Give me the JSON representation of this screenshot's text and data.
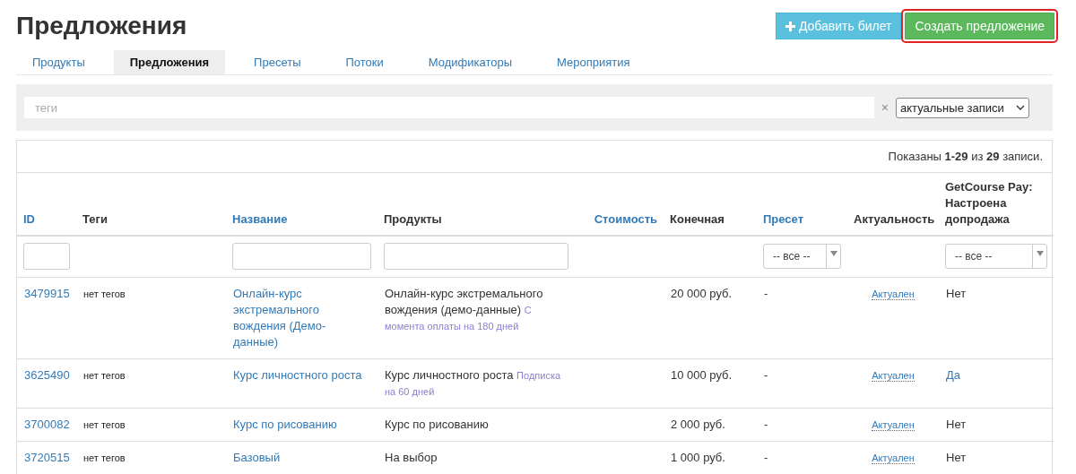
{
  "page_title": "Предложения",
  "actions": [
    {
      "kind": "add",
      "label": "Добавить билет",
      "highlighted": false
    },
    {
      "kind": "create",
      "label": "Создать предложение",
      "highlighted": true
    }
  ],
  "tabs": [
    {
      "label": "Продукты",
      "selected": false
    },
    {
      "label": "Предложения",
      "selected": true
    },
    {
      "label": "Пресеты",
      "selected": false
    },
    {
      "label": "Потоки",
      "selected": false
    },
    {
      "label": "Модификаторы",
      "selected": false
    },
    {
      "label": "Мероприятия",
      "selected": false
    }
  ],
  "filter": {
    "tags_placeholder": "теги",
    "clear": "×",
    "scope": "актуальные записи"
  },
  "table": {
    "summary": "Показаны **1-29** из **29** записи.",
    "columns": [
      {
        "label": "ID",
        "sortable": true,
        "filter": {
          "kind": "input"
        }
      },
      {
        "label": "Теги",
        "sortable": false
      },
      {
        "label": "Название",
        "sortable": true,
        "filter": {
          "kind": "input"
        }
      },
      {
        "label": "Продукты",
        "sortable": false,
        "filter": {
          "kind": "input"
        }
      },
      {
        "label": "Стоимость",
        "sortable": true
      },
      {
        "label": "Конечная",
        "sortable": false
      },
      {
        "label": "Пресет",
        "sortable": true,
        "filter": {
          "kind": "select",
          "value": "-- все --"
        }
      },
      {
        "label": "Актуальность",
        "sortable": false
      },
      {
        "label": "GetCourse Pay: Настроена допродажа",
        "sortable": false,
        "filter": {
          "kind": "select",
          "value": "-- все --"
        }
      }
    ],
    "rows": [
      {
        "id": "3479915",
        "tags": "нет тегов",
        "name": "Онлайн-курс экстремального вождения (Демо-данные)",
        "product": "Онлайн-курс экстремального вождения (демо-данные)",
        "product_note": "С момента оплаты на 180 дней",
        "price": "20 000 руб.",
        "preset": "-",
        "status": "Актуален",
        "gcpay": {
          "text": "Нет",
          "linked": false
        }
      },
      {
        "id": "3625490",
        "tags": "нет тегов",
        "name": "Курс личностного роста",
        "product": "Курс личностного роста",
        "product_note": "Подписка на 60 дней",
        "price": "10 000 руб.",
        "preset": "-",
        "status": "Актуален",
        "gcpay": {
          "text": "Да",
          "linked": true
        }
      },
      {
        "id": "3700082",
        "tags": "нет тегов",
        "name": "Курс по рисованию",
        "product": "Курс по рисованию",
        "price": "2 000 руб.",
        "preset": "-",
        "status": "Актуален",
        "gcpay": {
          "text": "Нет",
          "linked": false
        }
      },
      {
        "id": "3720515",
        "tags": "нет тегов",
        "name": "Базовый",
        "product": "На выбор",
        "price": "1 000 руб.",
        "preset": "-",
        "status": "Актуален",
        "gcpay": {
          "text": "Нет",
          "linked": false
        }
      }
    ]
  }
}
